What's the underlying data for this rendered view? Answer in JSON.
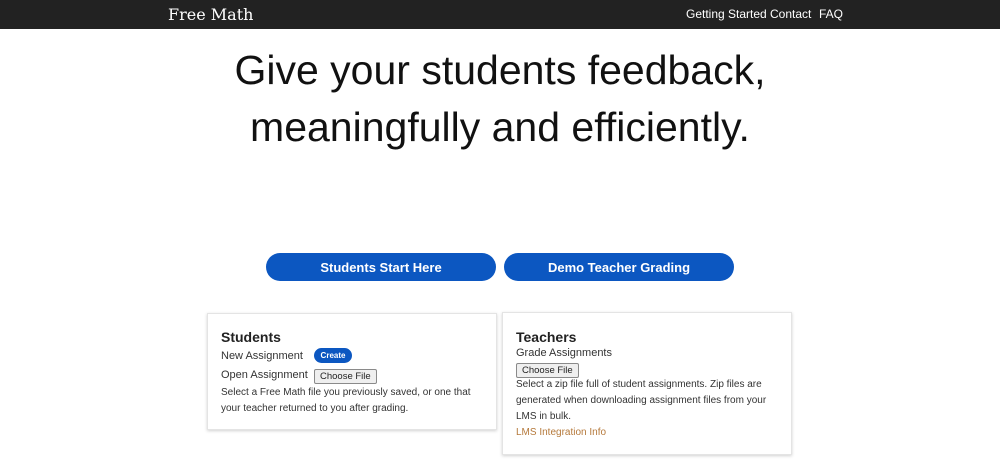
{
  "navbar": {
    "brand": "Free Math",
    "links": [
      "Getting Started",
      "Contact",
      "FAQ"
    ]
  },
  "hero": {
    "line1": "Give your students feedback,",
    "line2": "meaningfully and efficiently."
  },
  "buttons": {
    "students": "Students Start Here",
    "demo": "Demo Teacher Grading"
  },
  "students_card": {
    "title": "Students",
    "new_assignment": "New Assignment",
    "create": "Create",
    "open_assignment": "Open Assignment",
    "choose_file": "Choose File",
    "description": "Select a Free Math file you previously saved, or one that your teacher returned to you after grading."
  },
  "teachers_card": {
    "title": "Teachers",
    "grade_assignments": "Grade Assignments",
    "choose_file": "Choose File",
    "description": "Select a zip file full of student assignments. Zip files are generated when downloading assignment files from your LMS in bulk.",
    "lms_link": "LMS Integration Info"
  },
  "colors": {
    "navbar_bg": "#222222",
    "primary_button": "#0c57c1",
    "link": "#b5793b"
  }
}
